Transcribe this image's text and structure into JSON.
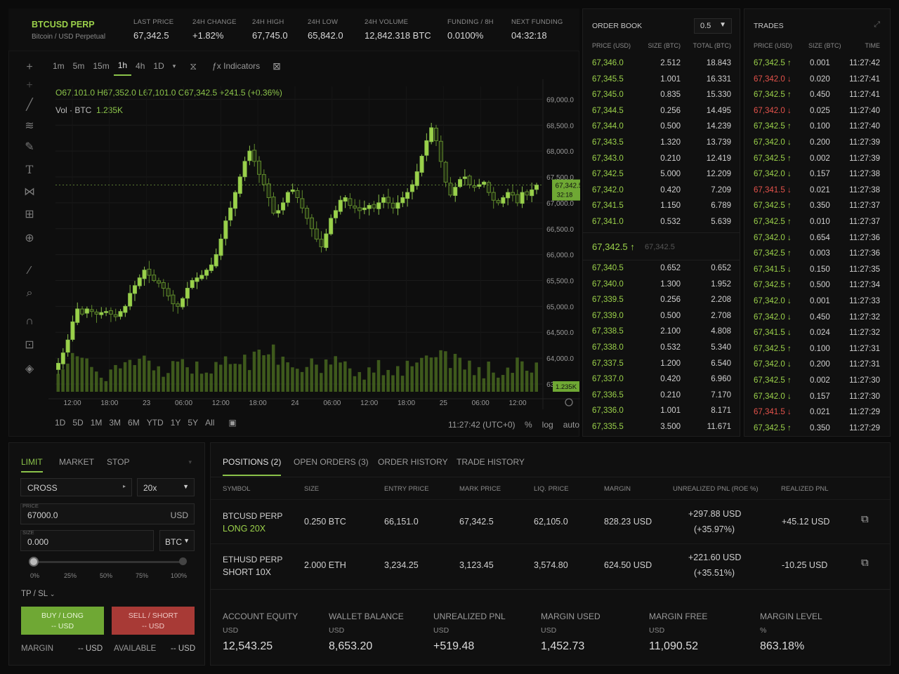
{
  "header": {
    "symbol": "BTCUSD PERP",
    "symbol_sub": "Bitcoin / USD Perpetual",
    "stats": [
      {
        "label": "LAST PRICE",
        "value": "67,342.5",
        "tone": "green"
      },
      {
        "label": "24H CHANGE",
        "value": "+1.82%",
        "tone": "green"
      },
      {
        "label": "24H HIGH",
        "value": "67,745.0",
        "tone": "plain"
      },
      {
        "label": "24H LOW",
        "value": "65,842.0",
        "tone": "plain"
      },
      {
        "label": "24H VOLUME",
        "value": "12,842.318 BTC",
        "tone": "plain"
      },
      {
        "label": "FUNDING / 8H",
        "value": "0.0100%",
        "tone": "green"
      },
      {
        "label": "NEXT FUNDING",
        "value": "04:32:18",
        "tone": "plain"
      }
    ]
  },
  "chart": {
    "timeframes": [
      "1m",
      "5m",
      "15m",
      "1h",
      "4h",
      "1D"
    ],
    "active_timeframe": "1h",
    "indicators_label": "Indicators",
    "ohlc": "O67,101.0  H67,352.0  L67,101.0  C67,342.5  +241.5 (+0.36%)",
    "vol_label": "Vol · BTC",
    "vol_value": "1.235K",
    "price_tag": "67,342.5",
    "price_tag_sub": "32:18",
    "vol_tag": "1.235K",
    "ranges": [
      "1D",
      "5D",
      "1M",
      "3M",
      "6M",
      "YTD",
      "1Y",
      "5Y",
      "All"
    ],
    "clock": "11:27:42 (UTC+0)",
    "opts": [
      "%",
      "log",
      "auto"
    ]
  },
  "chart_data": {
    "type": "candlestick",
    "y_ticks": [
      "69,000.0",
      "68,500.0",
      "68,000.0",
      "67,500.0",
      "67,000.0",
      "66,500.0",
      "66,000.0",
      "65,500.0",
      "65,000.0",
      "64,500.0",
      "64,000.0",
      "63,500.0"
    ],
    "ylim": [
      63350,
      69250
    ],
    "x_ticks": [
      "12:00",
      "18:00",
      "23",
      "06:00",
      "12:00",
      "18:00",
      "24",
      "06:00",
      "12:00",
      "18:00",
      "25",
      "06:00",
      "12:00"
    ],
    "close_series": [
      63900,
      64100,
      64350,
      64700,
      64950,
      64850,
      64950,
      64900,
      64850,
      64880,
      64900,
      64850,
      64800,
      64900,
      65000,
      65250,
      65400,
      65550,
      65700,
      65600,
      65500,
      65450,
      65350,
      65200,
      65050,
      65000,
      65150,
      65350,
      65500,
      65550,
      65600,
      65700,
      65800,
      66000,
      66300,
      66650,
      66900,
      67200,
      67500,
      67800,
      68000,
      67800,
      67550,
      67350,
      67100,
      66800,
      66850,
      67000,
      67200,
      67250,
      67100,
      66900,
      66700,
      66500,
      66300,
      66150,
      66400,
      66700,
      66850,
      67050,
      67100,
      66950,
      66900,
      66850,
      66900,
      66950,
      66900,
      67000,
      67100,
      67000,
      66900,
      67000,
      67100,
      67200,
      67350,
      67600,
      67900,
      68200,
      68450,
      68200,
      67800,
      67400,
      67150,
      67300,
      67450,
      67500,
      67350,
      67300,
      67350,
      67400,
      67200,
      67050,
      67000,
      67100,
      67200,
      67150,
      67000,
      67200,
      67150,
      67250,
      67342.5
    ]
  },
  "orderbook": {
    "title": "ORDER BOOK",
    "step": "0.5",
    "cols": [
      "PRICE (USD)",
      "SIZE (BTC)",
      "TOTAL (BTC)"
    ],
    "asks": [
      [
        "67,346.0",
        "2.512",
        "18.843"
      ],
      [
        "67,345.5",
        "1.001",
        "16.331"
      ],
      [
        "67,345.0",
        "0.835",
        "15.330"
      ],
      [
        "67,344.5",
        "0.256",
        "14.495"
      ],
      [
        "67,344.0",
        "0.500",
        "14.239"
      ],
      [
        "67,343.5",
        "1.320",
        "13.739"
      ],
      [
        "67,343.0",
        "0.210",
        "12.419"
      ],
      [
        "67,342.5",
        "5.000",
        "12.209"
      ],
      [
        "67,342.0",
        "0.420",
        "7.209"
      ],
      [
        "67,341.5",
        "1.150",
        "6.789"
      ],
      [
        "67,341.0",
        "0.532",
        "5.639"
      ]
    ],
    "mid_price": "67,342.5 ↑",
    "mid_mark": "67,342.5",
    "bids": [
      [
        "67,340.5",
        "0.652",
        "0.652"
      ],
      [
        "67,340.0",
        "1.300",
        "1.952"
      ],
      [
        "67,339.5",
        "0.256",
        "2.208"
      ],
      [
        "67,339.0",
        "0.500",
        "2.708"
      ],
      [
        "67,338.5",
        "2.100",
        "4.808"
      ],
      [
        "67,338.0",
        "0.532",
        "5.340"
      ],
      [
        "67,337.5",
        "1.200",
        "6.540"
      ],
      [
        "67,337.0",
        "0.420",
        "6.960"
      ],
      [
        "67,336.5",
        "0.210",
        "7.170"
      ],
      [
        "67,336.0",
        "1.001",
        "8.171"
      ],
      [
        "67,335.5",
        "3.500",
        "11.671"
      ]
    ]
  },
  "trades": {
    "title": "TRADES",
    "cols": [
      "PRICE (USD)",
      "SIZE (BTC)",
      "TIME"
    ],
    "rows": [
      [
        "67,342.5 ↑",
        "0.001",
        "11:27:42",
        "g"
      ],
      [
        "67,342.0 ↓",
        "0.020",
        "11:27:41",
        "r"
      ],
      [
        "67,342.5 ↑",
        "0.450",
        "11:27:41",
        "g"
      ],
      [
        "67,342.0 ↓",
        "0.025",
        "11:27:40",
        "r"
      ],
      [
        "67,342.5 ↑",
        "0.100",
        "11:27:40",
        "g"
      ],
      [
        "67,342.0 ↓",
        "0.200",
        "11:27:39",
        "g"
      ],
      [
        "67,342.5 ↑",
        "0.002",
        "11:27:39",
        "g"
      ],
      [
        "67,342.0 ↓",
        "0.157",
        "11:27:38",
        "g"
      ],
      [
        "67,341.5 ↓",
        "0.021",
        "11:27:38",
        "r"
      ],
      [
        "67,342.5 ↑",
        "0.350",
        "11:27:37",
        "g"
      ],
      [
        "67,342.5 ↑",
        "0.010",
        "11:27:37",
        "g"
      ],
      [
        "67,342.0 ↓",
        "0.654",
        "11:27:36",
        "g"
      ],
      [
        "67,342.5 ↑",
        "0.003",
        "11:27:36",
        "g"
      ],
      [
        "67,341.5 ↓",
        "0.150",
        "11:27:35",
        "g"
      ],
      [
        "67,342.5 ↑",
        "0.500",
        "11:27:34",
        "g"
      ],
      [
        "67,342.0 ↓",
        "0.001",
        "11:27:33",
        "g"
      ],
      [
        "67,342.0 ↓",
        "0.450",
        "11:27:32",
        "g"
      ],
      [
        "67,341.5 ↓",
        "0.024",
        "11:27:32",
        "g"
      ],
      [
        "67,342.5 ↑",
        "0.100",
        "11:27:31",
        "g"
      ],
      [
        "67,342.0 ↓",
        "0.200",
        "11:27:31",
        "g"
      ],
      [
        "67,342.5 ↑",
        "0.002",
        "11:27:30",
        "g"
      ],
      [
        "67,342.0 ↓",
        "0.157",
        "11:27:30",
        "g"
      ],
      [
        "67,341.5 ↓",
        "0.021",
        "11:27:29",
        "r"
      ],
      [
        "67,342.5 ↑",
        "0.350",
        "11:27:29",
        "g"
      ]
    ]
  },
  "order_form": {
    "tabs": [
      "LIMIT",
      "MARKET",
      "STOP"
    ],
    "margin_mode": "CROSS",
    "leverage": "20x",
    "price_label": "PRICE",
    "price_value": "67000.0",
    "price_unit": "USD",
    "size_label": "SIZE",
    "size_value": "0.000",
    "size_unit": "BTC",
    "slider_marks": [
      "0%",
      "25%",
      "50%",
      "75%",
      "100%"
    ],
    "tpsl": "TP / SL",
    "buy_line1": "BUY / LONG",
    "buy_line2": "-- USD",
    "sell_line1": "SELL / SHORT",
    "sell_line2": "-- USD",
    "margin_label": "MARGIN",
    "margin_value": "-- USD",
    "available_label": "AVAILABLE",
    "available_value": "-- USD"
  },
  "positions": {
    "tabs": [
      "POSITIONS (2)",
      "OPEN ORDERS (3)",
      "ORDER HISTORY",
      "TRADE HISTORY"
    ],
    "cols": [
      "SYMBOL",
      "SIZE",
      "ENTRY PRICE",
      "MARK PRICE",
      "LIQ. PRICE",
      "MARGIN",
      "UNREALIZED PNL (ROE %)",
      "REALIZED PNL"
    ],
    "rows": [
      {
        "symbol": "BTCUSD PERP",
        "side": "LONG 20X",
        "side_tone": "long",
        "size": "0.250 BTC",
        "entry": "66,151.0",
        "mark": "67,342.5",
        "liq": "62,105.0",
        "margin": "828.23 USD",
        "upnl": "+297.88 USD",
        "roe": "(+35.97%)",
        "rpnl": "+45.12 USD",
        "rpnl_tone": "green"
      },
      {
        "symbol": "ETHUSD PERP",
        "side": "SHORT 10X",
        "side_tone": "short",
        "size": "2.000 ETH",
        "entry": "3,234.25",
        "mark": "3,123.45",
        "liq": "3,574.80",
        "margin": "624.50 USD",
        "upnl": "+221.60 USD",
        "roe": "(+35.51%)",
        "rpnl": "-10.25 USD",
        "rpnl_tone": "red"
      }
    ],
    "account": [
      {
        "name": "ACCOUNT EQUITY",
        "unit": "USD",
        "value": "12,543.25",
        "tone": "plain"
      },
      {
        "name": "WALLET BALANCE",
        "unit": "USD",
        "value": "8,653.20",
        "tone": "plain"
      },
      {
        "name": "UNREALIZED PNL",
        "unit": "USD",
        "value": "+519.48",
        "tone": "green"
      },
      {
        "name": "MARGIN USED",
        "unit": "USD",
        "value": "1,452.73",
        "tone": "plain"
      },
      {
        "name": "MARGIN FREE",
        "unit": "USD",
        "value": "11,090.52",
        "tone": "plain"
      },
      {
        "name": "MARGIN LEVEL",
        "unit": "%",
        "value": "863.18%",
        "tone": "green"
      }
    ]
  },
  "colors": {
    "accent": "#8bc34a",
    "down": "#e5534b",
    "bg": "#0b0b0b"
  }
}
